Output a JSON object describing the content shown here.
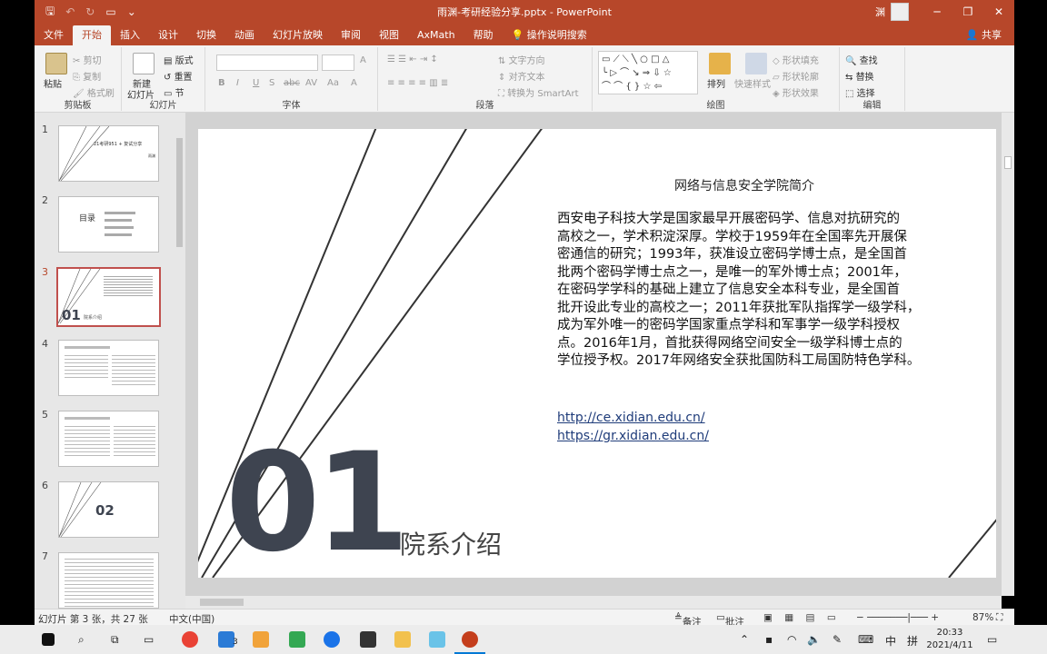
{
  "window": {
    "title": "雨渊-考研经验分享.pptx - PowerPoint",
    "user": "渊",
    "controls": [
      "─",
      "❐",
      "✕"
    ]
  },
  "qat": {
    "save": "🖫",
    "undo": "↶",
    "redo": "↻",
    "present": "▭",
    "more": "⌄"
  },
  "tabs": [
    "文件",
    "开始",
    "插入",
    "设计",
    "切换",
    "动画",
    "幻灯片放映",
    "审阅",
    "视图",
    "AxMath",
    "帮助"
  ],
  "active_tab": "开始",
  "tell_me": "操作说明搜索",
  "share": "共享",
  "ribbon": {
    "clipboard": {
      "paste": "粘贴",
      "cut": "剪切",
      "copy": "复制",
      "format_painter": "格式刷",
      "label": "剪贴板"
    },
    "slides": {
      "new_slide": "新建",
      "new_slide2": "幻灯片",
      "layout": "版式",
      "reset": "重置",
      "section": "节",
      "label": "幻灯片"
    },
    "font": {
      "label": "字体",
      "bold": "B",
      "italic": "I",
      "underline": "U",
      "shadow": "S",
      "strike": "abc",
      "spacing": "AV",
      "case": "Aa",
      "color": "A"
    },
    "paragraph": {
      "text_direction": "文字方向",
      "align_text": "对齐文本",
      "smartart": "转换为 SmartArt",
      "label": "段落"
    },
    "drawing": {
      "arrange": "排列",
      "quick_styles": "快速样式",
      "shape_fill": "形状填充",
      "shape_outline": "形状轮廓",
      "shape_effects": "形状效果",
      "label": "绘图"
    },
    "editing": {
      "find": "查找",
      "replace": "替换",
      "select": "选择",
      "label": "编辑"
    }
  },
  "thumbnails": [
    {
      "num": "1",
      "text": "21考研951 + 复试分享",
      "sub": "雨渊"
    },
    {
      "num": "2",
      "text": "目录"
    },
    {
      "num": "3",
      "text": "01",
      "sub": "院系介绍",
      "active": true
    },
    {
      "num": "4",
      "text": ""
    },
    {
      "num": "5",
      "text": ""
    },
    {
      "num": "6",
      "text": "02"
    },
    {
      "num": "7",
      "text": ""
    }
  ],
  "slide": {
    "heading": "网络与信息安全学院简介",
    "body_lines": [
      "西安电子科技大学是国家最早开展密码学、信息对抗研究的",
      "高校之一，学术积淀深厚。学校于1959年在全国率先开展保",
      "密通信的研究；1993年，获准设立密码学博士点，是全国首",
      "批两个密码学博士点之一，是唯一的军外博士点；2001年，",
      "在密码学学科的基础上建立了信息安全本科专业，是全国首",
      "批开设此专业的高校之一；2011年获批军队指挥学一级学科，",
      "成为军外唯一的密码学国家重点学科和军事学一级学科授权",
      "点。2016年1月，首批获得网络空间安全一级学科博士点的",
      "学位授予权。2017年网络安全获批国防科工局国防特色学科。"
    ],
    "link1": "http://ce.xidian.edu.cn/",
    "link2": "https://gr.xidian.edu.cn/",
    "number": "01",
    "section_title": "院系介绍"
  },
  "status": {
    "slide_info": "幻灯片 第 3 张，共 27 张",
    "language": "中文(中国)",
    "notes": "备注",
    "comments": "批注",
    "zoom": "87%"
  },
  "taskbar": {
    "time": "20:33",
    "date": "2021/4/11",
    "ime": "中",
    "ime2": "拼",
    "badge": "3"
  },
  "colors": {
    "accent": "#b7472a",
    "number": "#3e4450",
    "link": "#1f3c7a"
  }
}
